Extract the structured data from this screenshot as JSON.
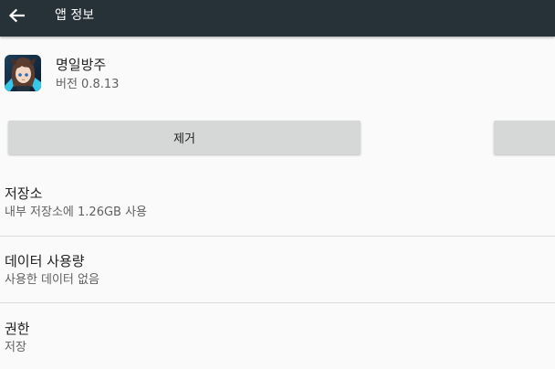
{
  "toolbar": {
    "title": "앱 정보",
    "back_icon": "arrow-left-icon",
    "background": "#263238"
  },
  "app": {
    "name": "명일방주",
    "version": "버전 0.8.13"
  },
  "buttons": {
    "uninstall": "제거",
    "force_stop": ""
  },
  "sections": [
    {
      "title": "저장소",
      "summary": "내부 저장소에 1.26GB 사용"
    },
    {
      "title": "데이터 사용량",
      "summary": "사용한 데이터 없음"
    },
    {
      "title": "권한",
      "summary": "저장"
    }
  ]
}
